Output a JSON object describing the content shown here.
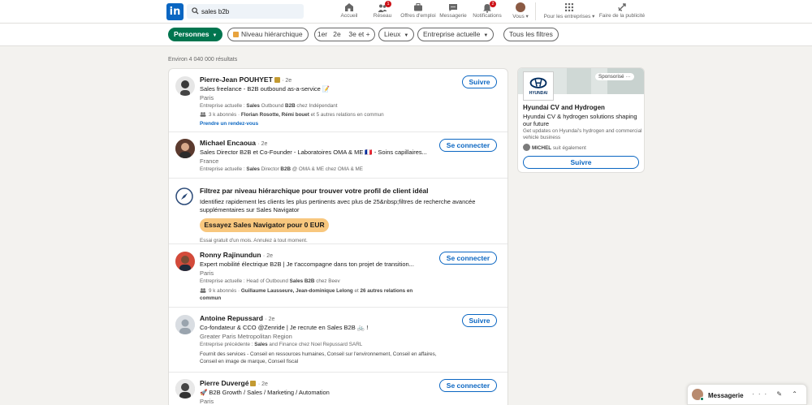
{
  "nav": {
    "logo": "in",
    "search_value": "sales b2b",
    "items": [
      {
        "label": "Accueil",
        "badge": ""
      },
      {
        "label": "Réseau",
        "badge": "1"
      },
      {
        "label": "Offres d'emploi",
        "badge": ""
      },
      {
        "label": "Messagerie",
        "badge": ""
      },
      {
        "label": "Notifications",
        "badge": "2"
      },
      {
        "label": "Vous ▾",
        "badge": ""
      },
      {
        "label": "Pour les entreprises ▾",
        "badge": ""
      },
      {
        "label": "Faire de la publicité",
        "badge": ""
      }
    ]
  },
  "filters": {
    "people": "Personnes",
    "level": "Niveau hiérarchique",
    "degrees": [
      "1er",
      "2e",
      "3e et +"
    ],
    "places": "Lieux",
    "company": "Entreprise actuelle",
    "all": "Tous les filtres"
  },
  "results_count": "Environ 4 040 000 résultats",
  "results": [
    {
      "name": "Pierre-Jean POUHYET",
      "degree": "· 2e",
      "headline": "Sales freelance - B2B outbound as-a-service 📝",
      "location": "Paris",
      "company_line": {
        "prefix": "Entreprise actuelle : ",
        "bold": "Sales",
        "mid": " Outbound ",
        "bold2": "B2B",
        "suffix": " chez Indépendant"
      },
      "followers_line": {
        "prefix": "3 k abonnés · ",
        "bold": "Florian Rosotte, Rémi bouet",
        "suffix": " et 5 autres relations en commun"
      },
      "link": "Prendre un rendez-vous",
      "button": "Suivre"
    },
    {
      "name": "Michael Encaoua",
      "degree": "· 2e",
      "headline": "Sales Director B2B et Co-Founder - Laboratoires OMA & ME 🇫🇷 - Soins capillaires...",
      "location": "France",
      "company_line": {
        "prefix": "Entreprise actuelle : ",
        "bold": "Sales",
        "mid": " Director ",
        "bold2": "B2B",
        "suffix": " @ OMA & ME chez OMA & ME"
      },
      "button": "Se connecter"
    },
    {
      "name": "Ronny Rajinundun",
      "degree": "· 2e",
      "headline": "Expert mobilité électrique B2B | Je t'accompagne dans ton projet de transition...",
      "location": "Paris",
      "company_line": {
        "prefix": "Entreprise actuelle : Head of Outbound ",
        "bold": "Sales",
        "mid": " ",
        "bold2": "B2B",
        "suffix": " chez Beev"
      },
      "followers_line": {
        "prefix": "9 k abonnés · ",
        "bold": "Guillaume Lausseure, Jean-dominique Lelong",
        "suffix": " et ",
        "bold2": "26 autres relations en commun"
      },
      "button": "Se connecter"
    },
    {
      "name": "Antoine Repussard",
      "degree": "· 2e",
      "headline": "Co-fondateur & CCO @Zenride | Je recrute en Sales B2B 🚲 !",
      "location": "Greater Paris Metropolitan Region",
      "company_line": {
        "prefix": "Entreprise précédente : ",
        "bold": "Sales",
        "mid": " and Finance chez Noel Repussard SARL",
        "bold2": "",
        "suffix": ""
      },
      "services": "Fournit des services - Conseil en ressources humaines, Conseil sur l'environnement, Conseil en affaires, Conseil en image de marque, Conseil fiscal",
      "button": "Suivre"
    },
    {
      "name": "Pierre Duvergé",
      "degree": "· 2e",
      "headline": "🚀 B2B Growth / Sales / Marketing / Automation",
      "location": "Paris",
      "button": "Se connecter"
    }
  ],
  "promo": {
    "title": "Filtrez par niveau hiérarchique pour trouver votre profil de client idéal",
    "body": "Identifiez rapidement les clients les plus pertinents avec plus de 25&nbsp;filtres de recherche avancée supplémentaires sur Sales Navigator",
    "button": "Essayez Sales Navigator pour 0 EUR",
    "fine": "Essai gratuit d'un mois. Annulez à tout moment."
  },
  "ad": {
    "sponsored": "Sponsorisé ···",
    "logo_text": "HYUNDAI",
    "title": "Hyundai CV and Hydrogen",
    "tagline": "Hyundai CV & hydrogen solutions shaping our future",
    "desc": "Get updates on Hyundai's hydrogen and commercial vehicle business",
    "follower_name": "MICHEL",
    "follower_suffix": " suit également",
    "button": "Suivre"
  },
  "messaging": {
    "title": "Messagerie",
    "icons": "··· ✎ ⌃"
  },
  "colors": {
    "brand": "#0a66c2",
    "green": "#01754f",
    "promo": "#f8c77e",
    "badge": "#cc1016"
  }
}
